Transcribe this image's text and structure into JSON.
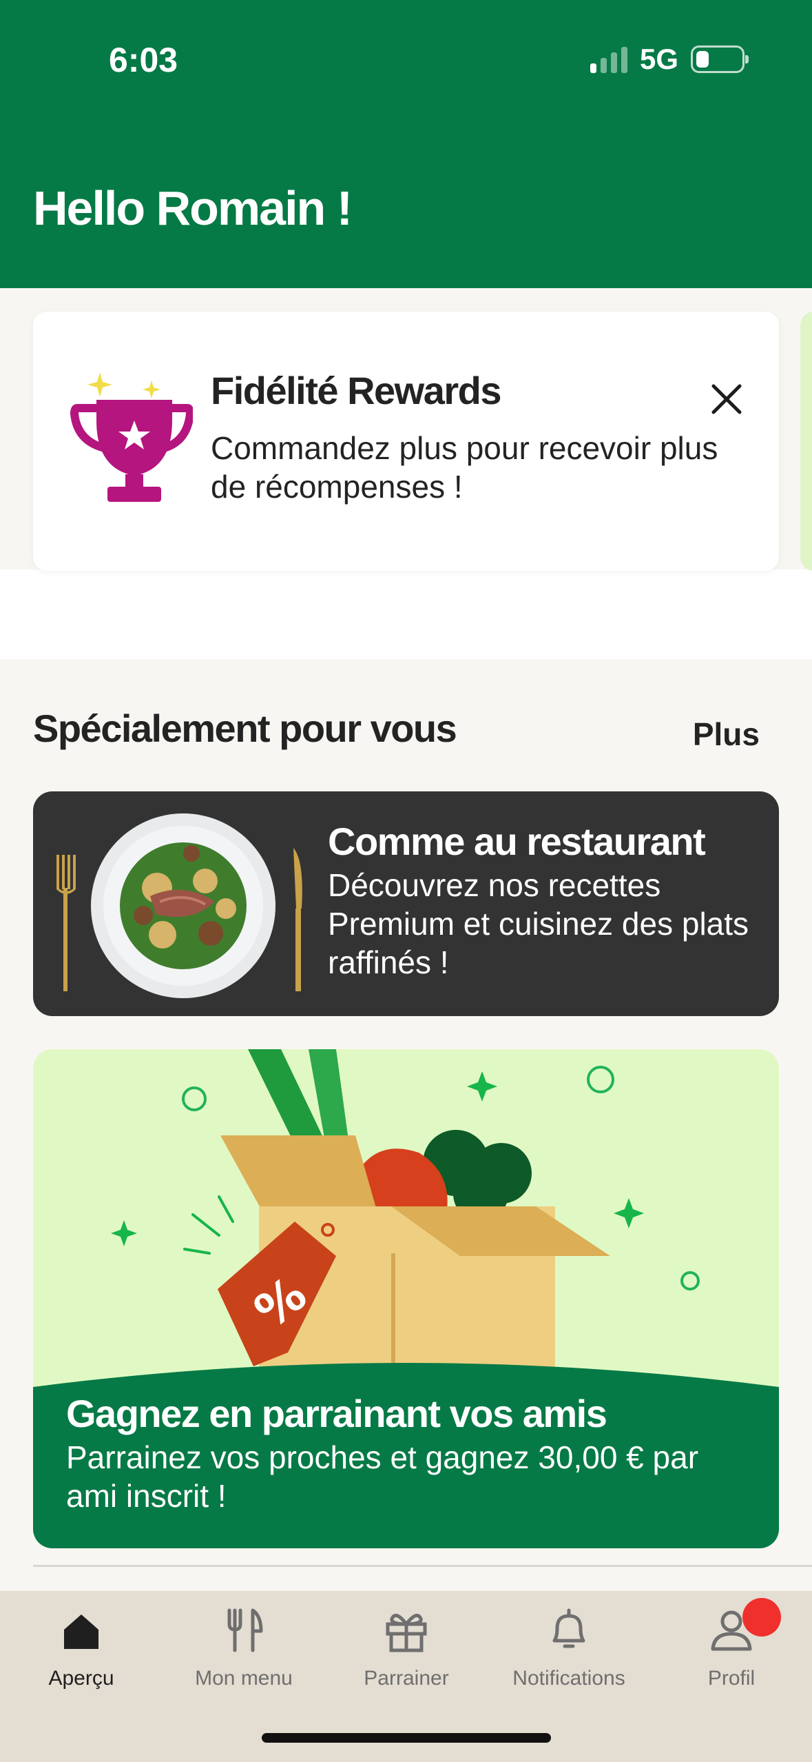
{
  "status_bar": {
    "time": "6:03",
    "network": "5G"
  },
  "header": {
    "greeting": "Hello Romain !"
  },
  "rewards_card": {
    "title": "Fidélité Rewards",
    "text": "Commandez plus pour recevoir plus de récompenses !",
    "icon": "trophy-icon",
    "close_icon": "close-icon"
  },
  "section": {
    "title": "Spécialement pour vous",
    "more_label": "Plus"
  },
  "premium_card": {
    "title": "Comme au restaurant",
    "text": "Découvrez nos recettes Premium et cuisinez des plats raffinés !"
  },
  "referral_card": {
    "title": "Gagnez en parrainant vos amis",
    "text": "Parrainez vos proches et gagnez 30,00 € par ami inscrit !"
  },
  "tabbar": {
    "items": [
      {
        "label": "Aperçu",
        "icon": "home-icon",
        "active": true
      },
      {
        "label": "Mon menu",
        "icon": "fork-knife-icon",
        "active": false
      },
      {
        "label": "Parrainer",
        "icon": "gift-icon",
        "active": false
      },
      {
        "label": "Notifications",
        "icon": "bell-icon",
        "active": false
      },
      {
        "label": "Profil",
        "icon": "person-icon",
        "active": false,
        "badge": true
      }
    ]
  },
  "colors": {
    "brand_green": "#067a46",
    "light_green": "#e0f9c4",
    "dark_card": "#333333",
    "tabbar_bg": "#e4ddd2",
    "badge_red": "#f0302c"
  }
}
